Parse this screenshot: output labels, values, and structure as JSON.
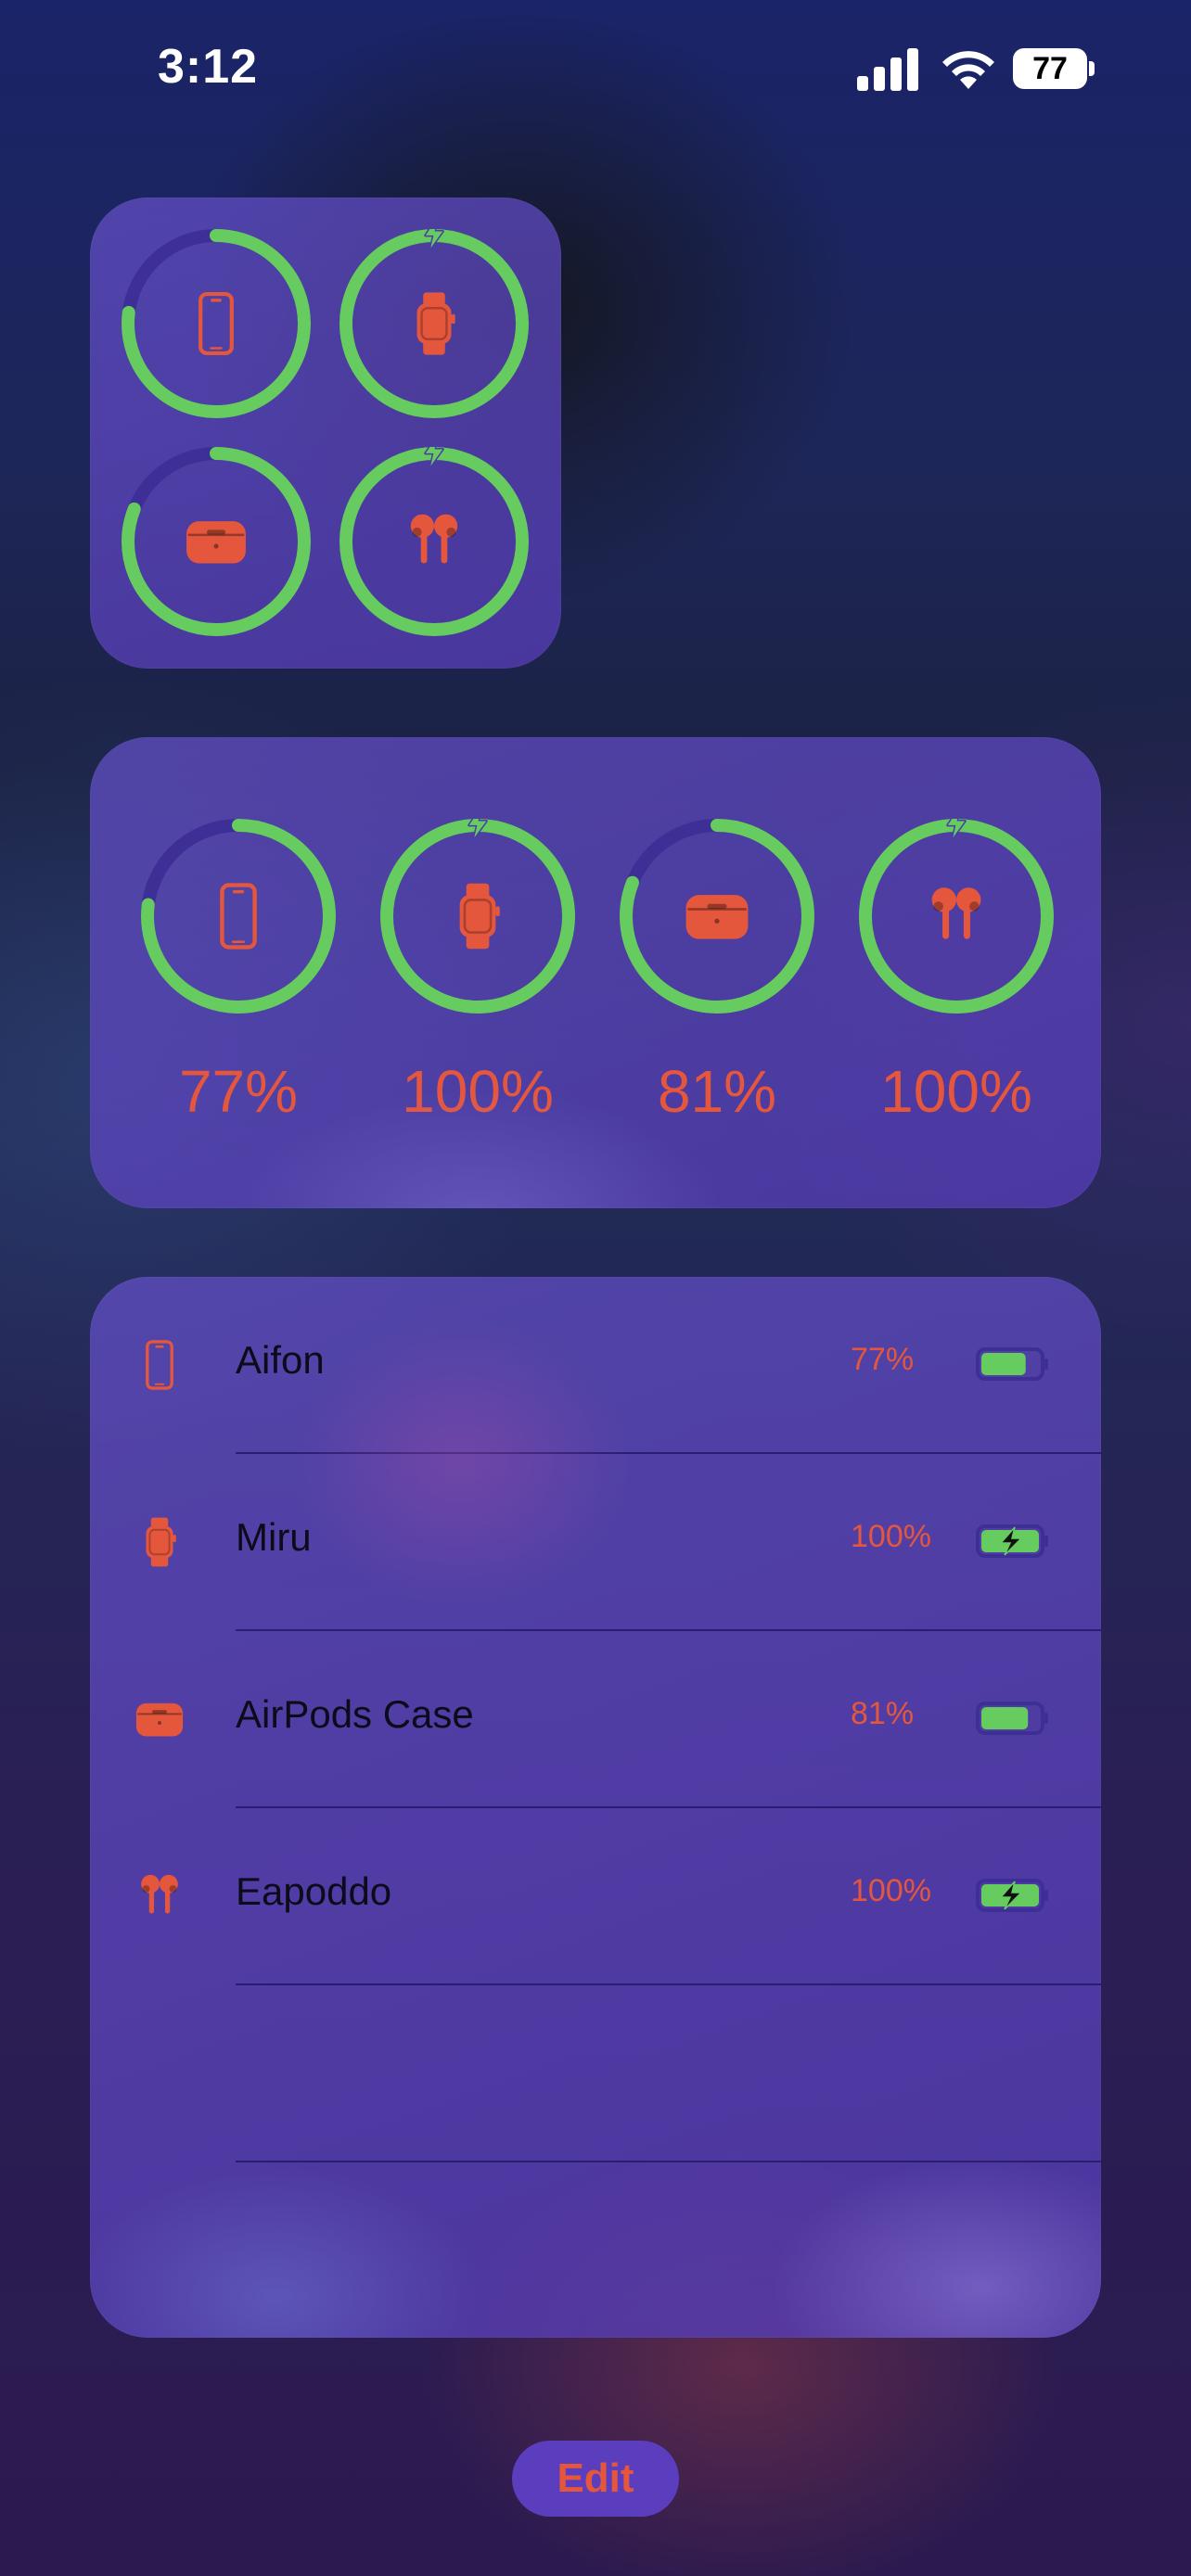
{
  "status_bar": {
    "time": "3:12",
    "battery_level": "77"
  },
  "colors": {
    "accent": "#e4573d",
    "ring": "#67cc5f",
    "ring_track": "#3d2f95",
    "widget": "#5b43b8"
  },
  "devices": [
    {
      "icon": "iphone-icon",
      "name": "Aifon",
      "percent": "77%",
      "level": 0.77,
      "charging": false
    },
    {
      "icon": "watch-icon",
      "name": "Miru",
      "percent": "100%",
      "level": 1.0,
      "charging": true
    },
    {
      "icon": "airpods-case-icon",
      "name": "AirPods Case",
      "percent": "81%",
      "level": 0.81,
      "charging": false
    },
    {
      "icon": "airpods-icon",
      "name": "Eapoddo",
      "percent": "100%",
      "level": 1.0,
      "charging": true
    }
  ],
  "edit_label": "Edit"
}
